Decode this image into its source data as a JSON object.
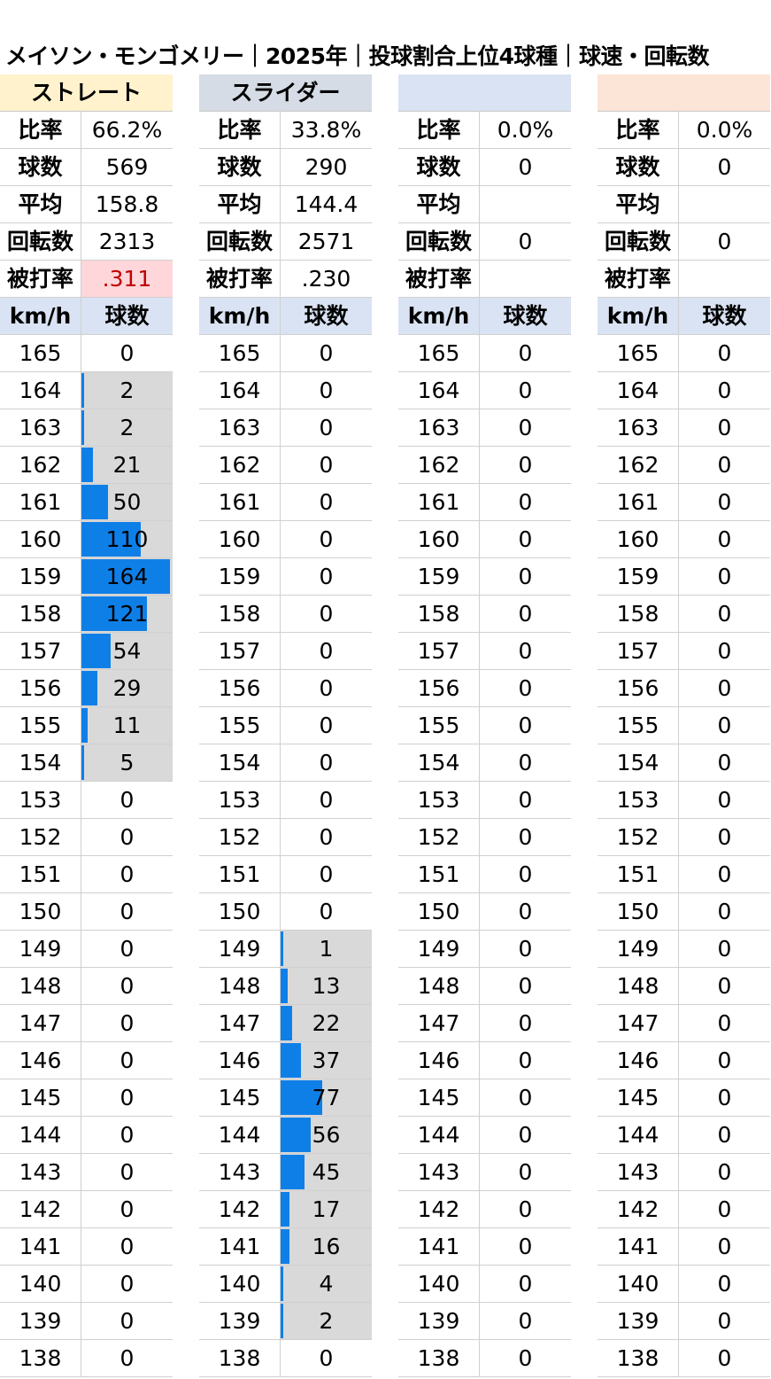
{
  "title": "メイソン・モンゴメリー｜2025年｜投球割合上位4球種｜球速・回転数",
  "labels": {
    "ratio": "比率",
    "count": "球数",
    "avg": "平均",
    "spin": "回転数",
    "ba": "被打率",
    "kmh": "km/h",
    "balls": "球数"
  },
  "colors": {
    "bar": "#0f7fe8",
    "bar_background": "#d9d9d9",
    "column_header": "#dae3f3",
    "highlight_bg": "#ffd6d9",
    "highlight_text": "#c00000"
  },
  "chart_data": {
    "type": "bar",
    "orientation": "horizontal",
    "speeds": [
      165,
      164,
      163,
      162,
      161,
      160,
      159,
      158,
      157,
      156,
      155,
      154,
      153,
      152,
      151,
      150,
      149,
      148,
      147,
      146,
      145,
      144,
      143,
      142,
      141,
      140,
      139,
      138
    ],
    "bar_max": 164,
    "panels": [
      {
        "name": "ストレート",
        "header_color": "#fff2cc",
        "ratio": "66.2%",
        "count": "569",
        "avg": "158.8",
        "spin": "2313",
        "ba": ".311",
        "ba_highlight": true,
        "values": [
          0,
          2,
          2,
          21,
          50,
          110,
          164,
          121,
          54,
          29,
          11,
          5,
          0,
          0,
          0,
          0,
          0,
          0,
          0,
          0,
          0,
          0,
          0,
          0,
          0,
          0,
          0,
          0
        ]
      },
      {
        "name": "スライダー",
        "header_color": "#d6dce5",
        "ratio": "33.8%",
        "count": "290",
        "avg": "144.4",
        "spin": "2571",
        "ba": ".230",
        "ba_highlight": false,
        "values": [
          0,
          0,
          0,
          0,
          0,
          0,
          0,
          0,
          0,
          0,
          0,
          0,
          0,
          0,
          0,
          0,
          1,
          13,
          22,
          37,
          77,
          56,
          45,
          17,
          16,
          4,
          2,
          0
        ]
      },
      {
        "name": "",
        "header_color": "#dae3f3",
        "ratio": "0.0%",
        "count": "0",
        "avg": "",
        "spin": "0",
        "ba": "",
        "ba_highlight": false,
        "values": [
          0,
          0,
          0,
          0,
          0,
          0,
          0,
          0,
          0,
          0,
          0,
          0,
          0,
          0,
          0,
          0,
          0,
          0,
          0,
          0,
          0,
          0,
          0,
          0,
          0,
          0,
          0,
          0
        ]
      },
      {
        "name": "",
        "header_color": "#fce4d6",
        "ratio": "0.0%",
        "count": "0",
        "avg": "",
        "spin": "0",
        "ba": "",
        "ba_highlight": false,
        "values": [
          0,
          0,
          0,
          0,
          0,
          0,
          0,
          0,
          0,
          0,
          0,
          0,
          0,
          0,
          0,
          0,
          0,
          0,
          0,
          0,
          0,
          0,
          0,
          0,
          0,
          0,
          0,
          0
        ]
      }
    ]
  }
}
